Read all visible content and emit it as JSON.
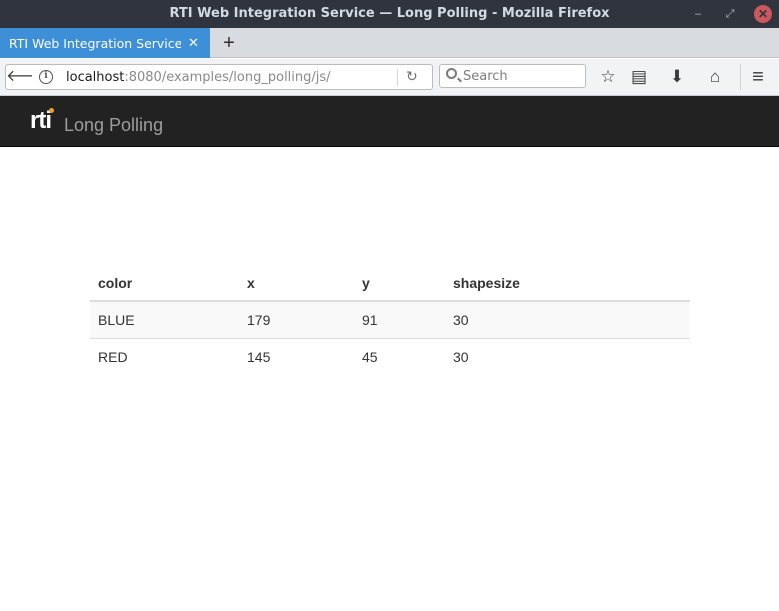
{
  "window": {
    "title": "RTI Web Integration Service — Long Polling - Mozilla Firefox",
    "min_glyph": "–",
    "max_glyph": "⤢",
    "close_glyph": "✕"
  },
  "tabs": [
    {
      "label": "RTI Web Integration Service — Long Polling",
      "close_glyph": "✕",
      "active": true
    }
  ],
  "new_tab_glyph": "+",
  "navbar": {
    "back_glyph": "🡐",
    "url_host": "localhost",
    "url_rest": ":8080/examples/long_polling/js/",
    "reload_glyph": "↻",
    "search_placeholder": "Search",
    "icons": [
      "bookmark-star-icon",
      "reading-list-icon",
      "downloads-icon",
      "home-icon",
      "menu-icon"
    ],
    "icon_glyphs": {
      "star": "☆",
      "library": "▤",
      "download": "⬇",
      "home": "⌂",
      "menu": "≡"
    }
  },
  "page": {
    "logo_text": "rti",
    "brand_title": "Long Polling",
    "table": {
      "headers": [
        "color",
        "x",
        "y",
        "shapesize"
      ],
      "rows": [
        [
          "BLUE",
          "179",
          "91",
          "30"
        ],
        [
          "RED",
          "145",
          "45",
          "30"
        ]
      ]
    },
    "accent_colors": {
      "tab_active": "#3d8fd7",
      "header_bg": "#222222",
      "logo_dot": "#f0a028",
      "close_button": "#cc575d"
    }
  }
}
